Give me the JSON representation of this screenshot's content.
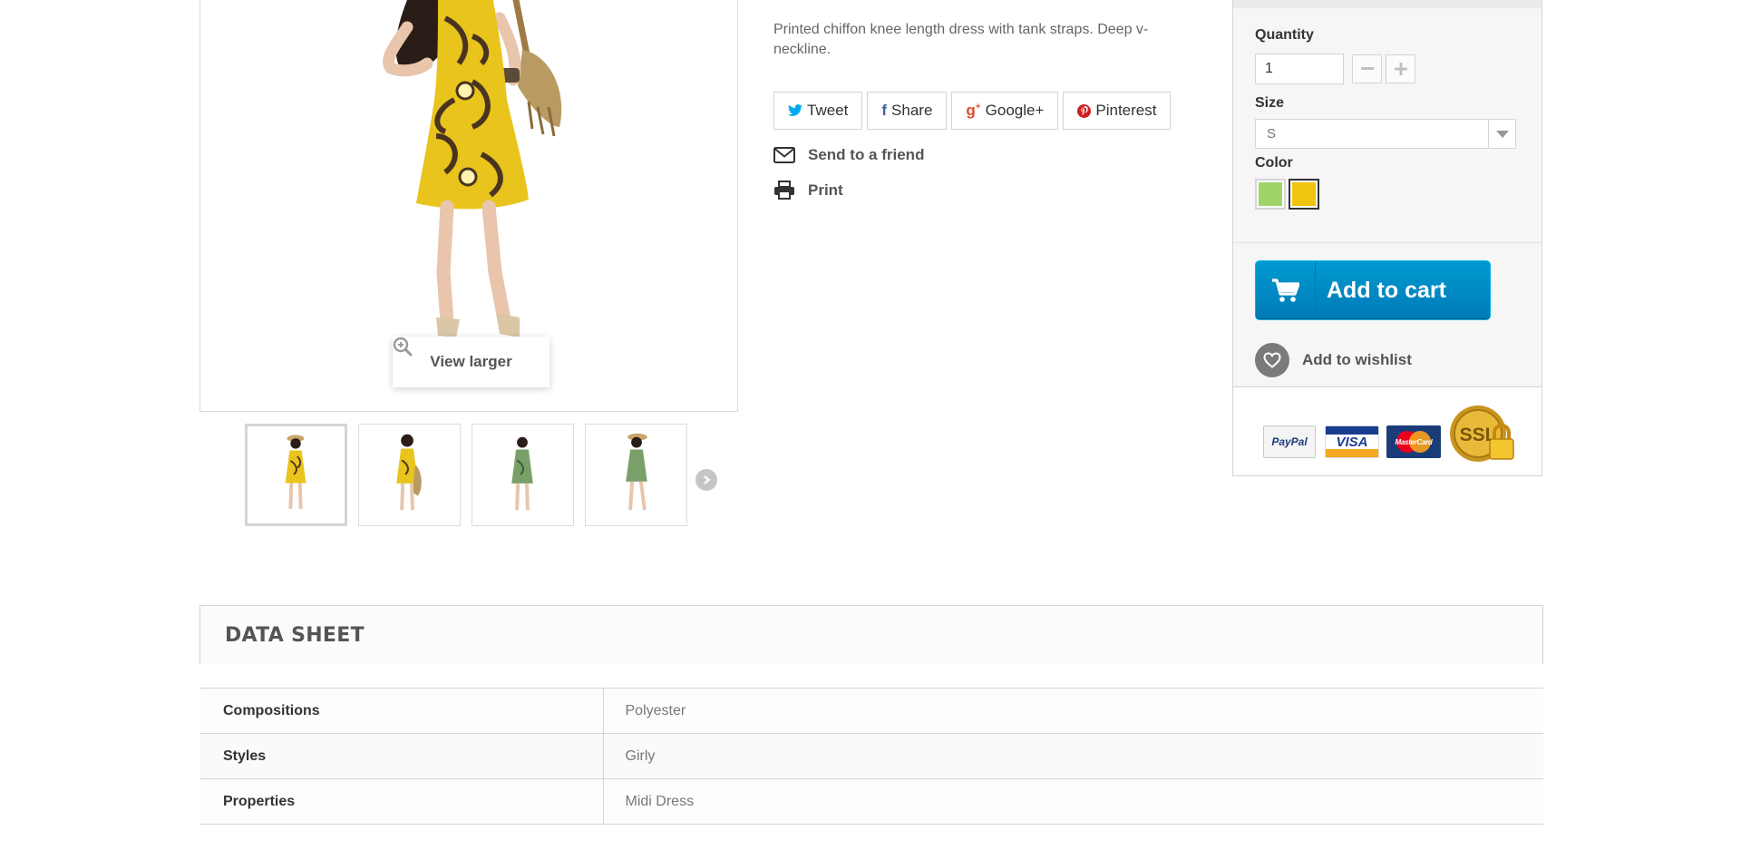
{
  "product": {
    "description": "Printed chiffon knee length dress with tank straps. Deep v-neckline.",
    "view_larger_label": "View larger",
    "thumbnail_count": 4
  },
  "social": {
    "tweet": "Tweet",
    "share": "Share",
    "google": "Google+",
    "pinterest": "Pinterest"
  },
  "actions": {
    "send_to_friend": "Send to a friend",
    "print": "Print"
  },
  "buy_box": {
    "quantity_label": "Quantity",
    "quantity_value": "1",
    "size_label": "Size",
    "size_value": "S",
    "color_label": "Color",
    "colors": [
      {
        "name": "green",
        "hex": "#a0d468",
        "selected": false
      },
      {
        "name": "yellow",
        "hex": "#f1c40f",
        "selected": true
      }
    ],
    "add_to_cart": "Add to cart",
    "add_to_wishlist": "Add to wishlist",
    "accent_color": "#0096d6"
  },
  "payment": {
    "paypal": "PayPal",
    "visa": "VISA",
    "mastercard": "MasterCard",
    "ssl": "SSL"
  },
  "data_sheet": {
    "title": "DATA SHEET",
    "rows": [
      {
        "key": "Compositions",
        "value": "Polyester"
      },
      {
        "key": "Styles",
        "value": "Girly"
      },
      {
        "key": "Properties",
        "value": "Midi Dress"
      }
    ]
  }
}
